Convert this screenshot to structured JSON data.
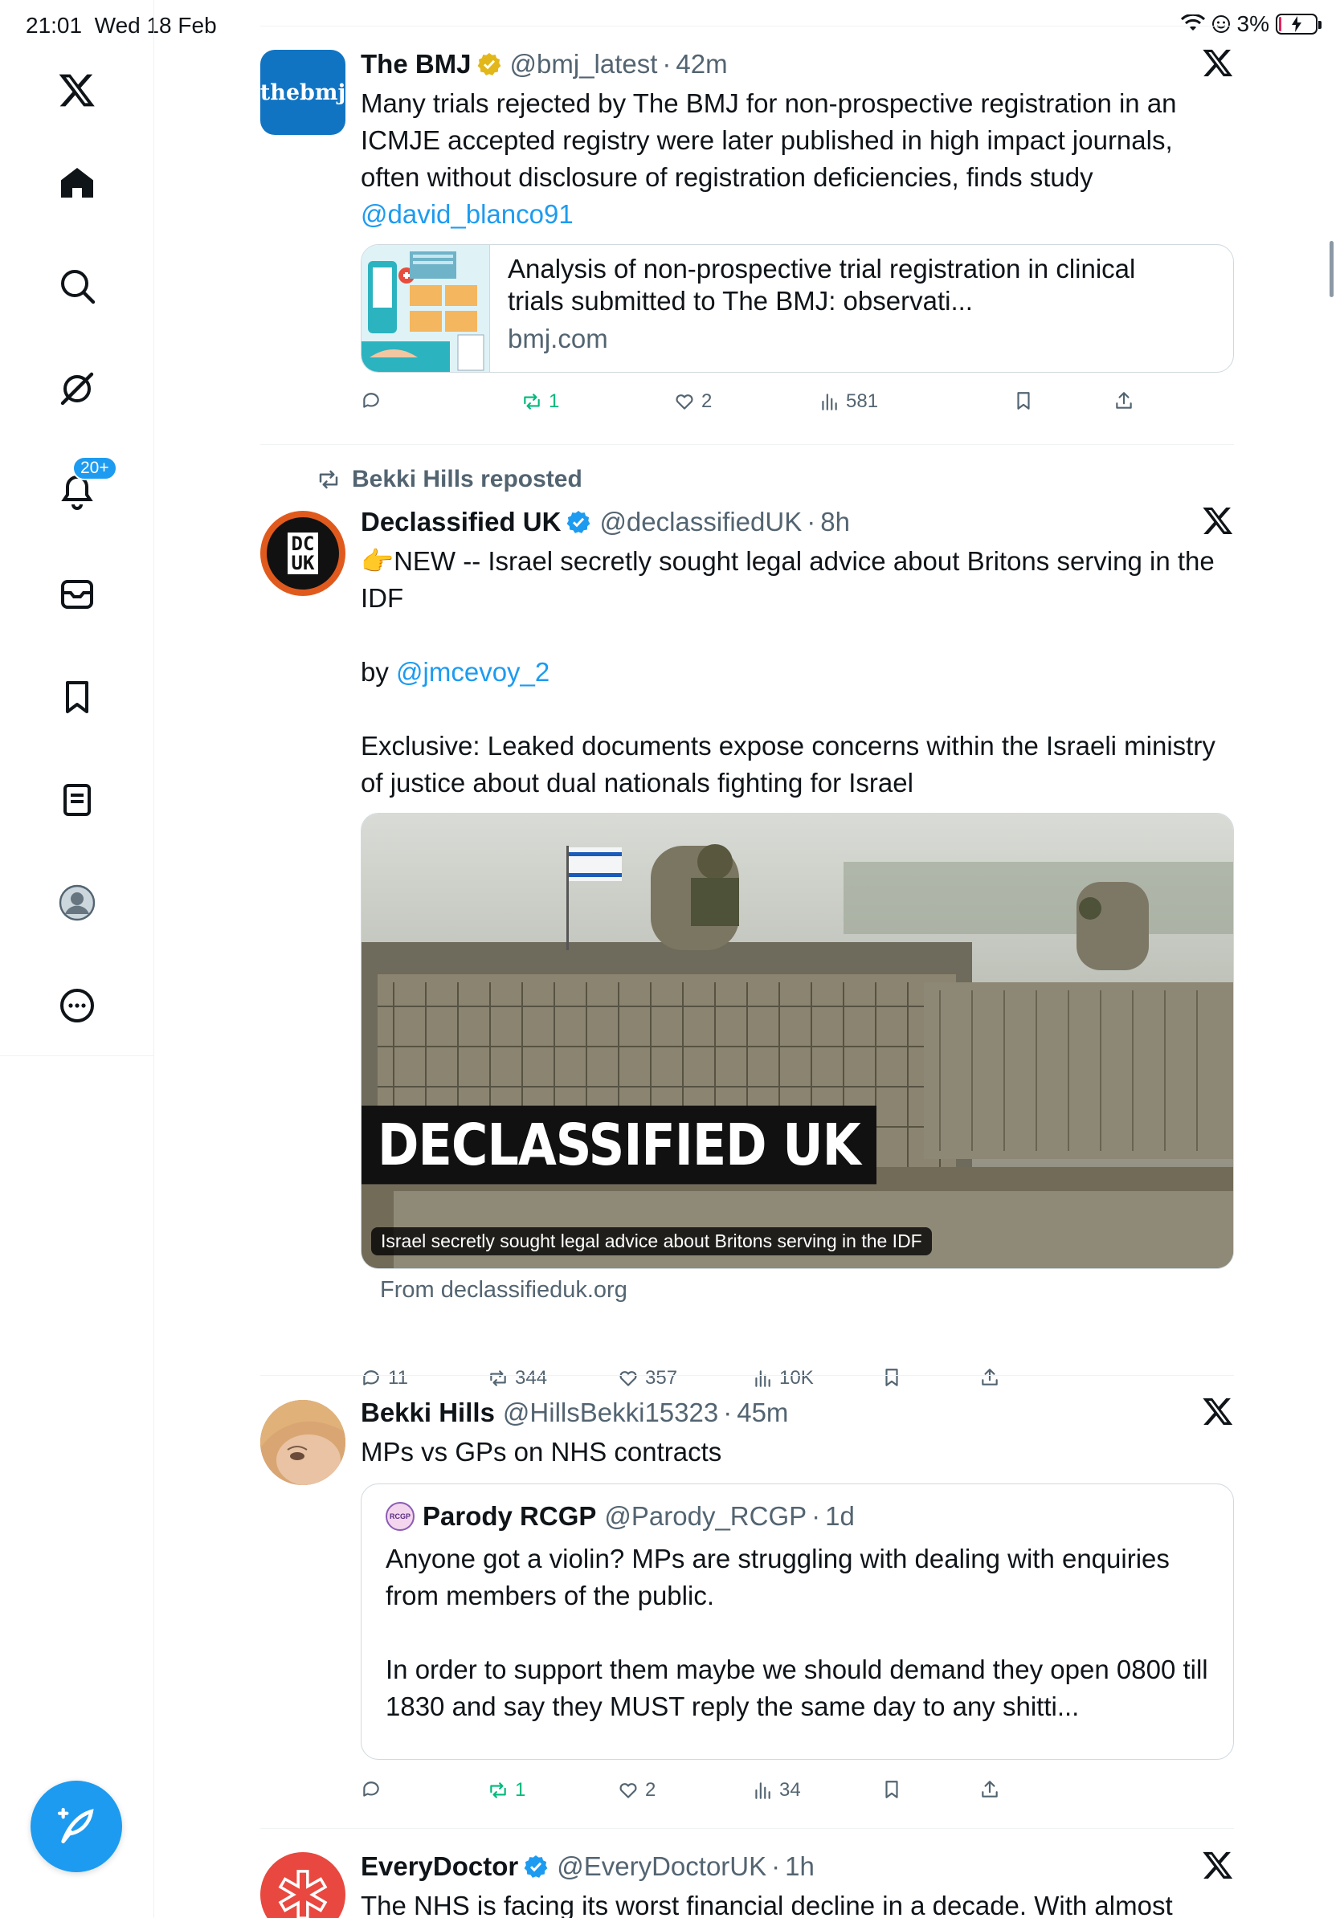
{
  "status_bar": {
    "time": "21:01",
    "date": "Wed 18 Feb",
    "battery": "3%"
  },
  "sidebar": {
    "notifications_badge": "20+",
    "items": [
      "home",
      "explore",
      "grok",
      "notifications",
      "messages",
      "bookmarks",
      "lists",
      "profile",
      "more"
    ]
  },
  "tweets": [
    {
      "name": "The BMJ",
      "handle": "@bmj_latest",
      "time": "42m",
      "avatar_text": "thebmj",
      "text_main": "Many trials rejected by The BMJ for non-prospective registration in an ICMJE accepted registry were later published in high impact journals, often without disclosure of registration deficiencies, finds study",
      "mention": "@david_blanco91",
      "card": {
        "title_line1": "Analysis of non-prospective trial registration in clinical",
        "title_line2": "trials submitted to The BMJ: observati...",
        "domain": "bmj.com"
      },
      "actions": {
        "replies": "",
        "reposts": "1",
        "likes": "2",
        "views": "581"
      }
    },
    {
      "repost_by": "Bekki Hills reposted",
      "name": "Declassified UK",
      "handle": "@declassifiedUK",
      "time": "8h",
      "avatar_text_top": "DC",
      "avatar_text_bottom": "UK",
      "text_line1": "👉NEW -- Israel secretly sought legal advice about Britons serving in the IDF",
      "text_by_prefix": "by ",
      "mention": "@jmcevoy_2",
      "text_line3": "Exclusive: Leaked documents expose concerns within the Israeli ministry of justice about dual nationals fighting for Israel",
      "media": {
        "brand": "DECLASSIFIED UK",
        "caption": "Israel secretly sought legal advice about Britons serving in the IDF",
        "source": "From declassifieduk.org"
      },
      "actions": {
        "replies": "11",
        "reposts": "344",
        "likes": "357",
        "views": "10K"
      }
    },
    {
      "name": "Bekki Hills",
      "handle": "@HillsBekki15323",
      "time": "45m",
      "text": "MPs vs GPs on NHS contracts",
      "quote": {
        "name": "Parody RCGP",
        "handle": "@Parody_RCGP",
        "time": "1d",
        "avatar_text": "RCGP",
        "text": "Anyone got a violin? MPs are struggling with dealing with enquiries from members of the public.\n\nIn order to support them maybe we should demand they open 0800 till 1830 and say they MUST reply the same day to any shitti..."
      },
      "actions": {
        "replies": "",
        "reposts": "1",
        "likes": "2",
        "views": "34"
      }
    },
    {
      "name": "EveryDoctor",
      "handle": "@EveryDoctorUK",
      "time": "1h",
      "text": "The NHS is facing its worst financial decline in a decade. With almost"
    }
  ],
  "colors": {
    "accent": "#1d9bf0",
    "repost_green": "#00ba7c",
    "secondary_text": "#536471",
    "verified_gold": "#e2b719"
  }
}
